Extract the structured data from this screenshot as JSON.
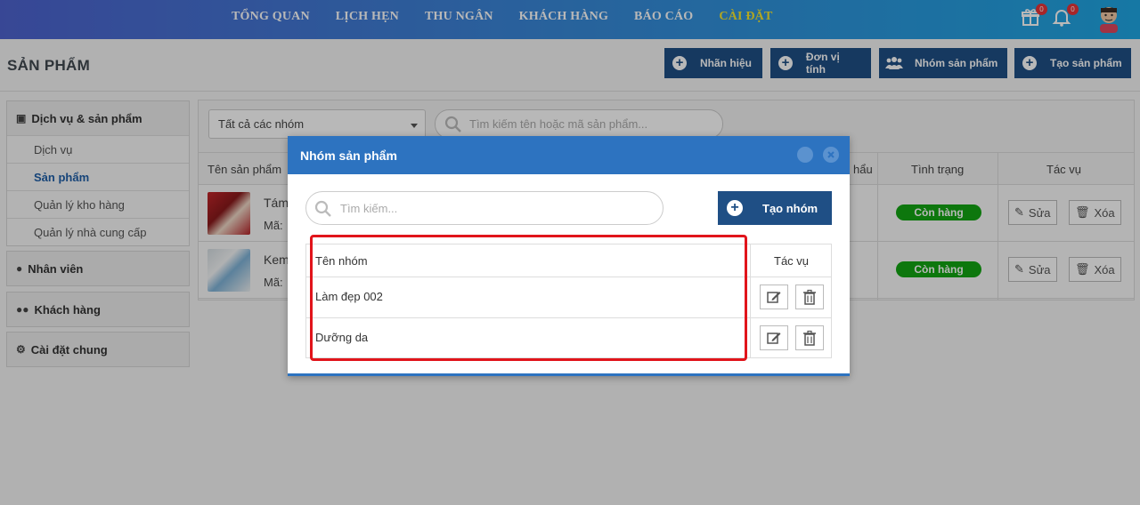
{
  "nav": {
    "items": [
      "TỔNG QUAN",
      "LỊCH HẸN",
      "THU NGÂN",
      "KHÁCH HÀNG",
      "BÁO CÁO",
      "CÀI ĐẶT"
    ],
    "active_index": 5,
    "gift_badge": "0",
    "bell_badge": "0"
  },
  "page": {
    "title": "SẢN PHẨM",
    "buttons": {
      "brand": "Nhãn hiệu",
      "unit": "Đơn vị tính",
      "group": "Nhóm sản phẩm",
      "create": "Tạo sản phẩm"
    }
  },
  "sidebar": {
    "group1": {
      "title": "Dịch vụ & sản phẩm",
      "items": [
        "Dịch vụ",
        "Sản phẩm",
        "Quản lý kho hàng",
        "Quản lý nhà cung cấp"
      ]
    },
    "staff": "Nhân viên",
    "customers": "Khách hàng",
    "settings": "Cài đặt chung"
  },
  "main": {
    "filter": "Tất cả các nhóm",
    "search_placeholder": "Tìm kiếm tên hoặc mã sản phẩm...",
    "headers": {
      "name": "Tên sản phẩm",
      "partial": "hẩu",
      "status": "Tình trạng",
      "actions": "Tác vụ"
    },
    "rows": [
      {
        "name": "Tám",
        "code": "Mã:",
        "status": "Còn hàng",
        "edit": "Sửa",
        "delete": "Xóa"
      },
      {
        "name": "Kem",
        "code": "Mã:",
        "status": "Còn hàng",
        "edit": "Sửa",
        "delete": "Xóa"
      }
    ]
  },
  "modal": {
    "title": "Nhóm sản phẩm",
    "search_placeholder": "Tìm kiếm...",
    "create_label": "Tạo nhóm",
    "col_name": "Tên nhóm",
    "col_actions": "Tác vụ",
    "groups": [
      "Làm đẹp 002",
      "Dưỡng da"
    ]
  }
}
